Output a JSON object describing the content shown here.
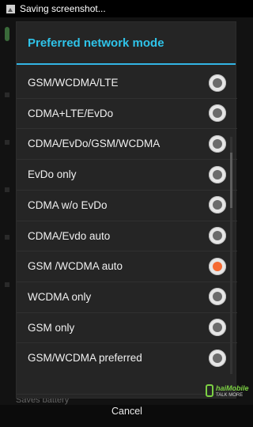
{
  "status_bar": {
    "notification_text": "Saving screenshot...",
    "icon": "picture-icon"
  },
  "background": {
    "partial_text": "Saves battery"
  },
  "dialog": {
    "title": "Preferred network mode",
    "options": [
      {
        "label": "GSM/WCDMA/LTE",
        "selected": false
      },
      {
        "label": "CDMA+LTE/EvDo",
        "selected": false
      },
      {
        "label": "CDMA/EvDo/GSM/WCDMA",
        "selected": false
      },
      {
        "label": "EvDo only",
        "selected": false
      },
      {
        "label": "CDMA w/o EvDo",
        "selected": false
      },
      {
        "label": "CDMA/Evdo auto",
        "selected": false
      },
      {
        "label": "GSM /WCDMA auto",
        "selected": true
      },
      {
        "label": "WCDMA only",
        "selected": false
      },
      {
        "label": "GSM only",
        "selected": false
      },
      {
        "label": "GSM/WCDMA preferred",
        "selected": false
      }
    ],
    "cancel_label": "Cancel"
  },
  "watermark": {
    "brand": "haiMobile",
    "tagline": "TALK MORE"
  },
  "colors": {
    "accent": "#33b5e5",
    "selected_radio": "#f56a32"
  }
}
